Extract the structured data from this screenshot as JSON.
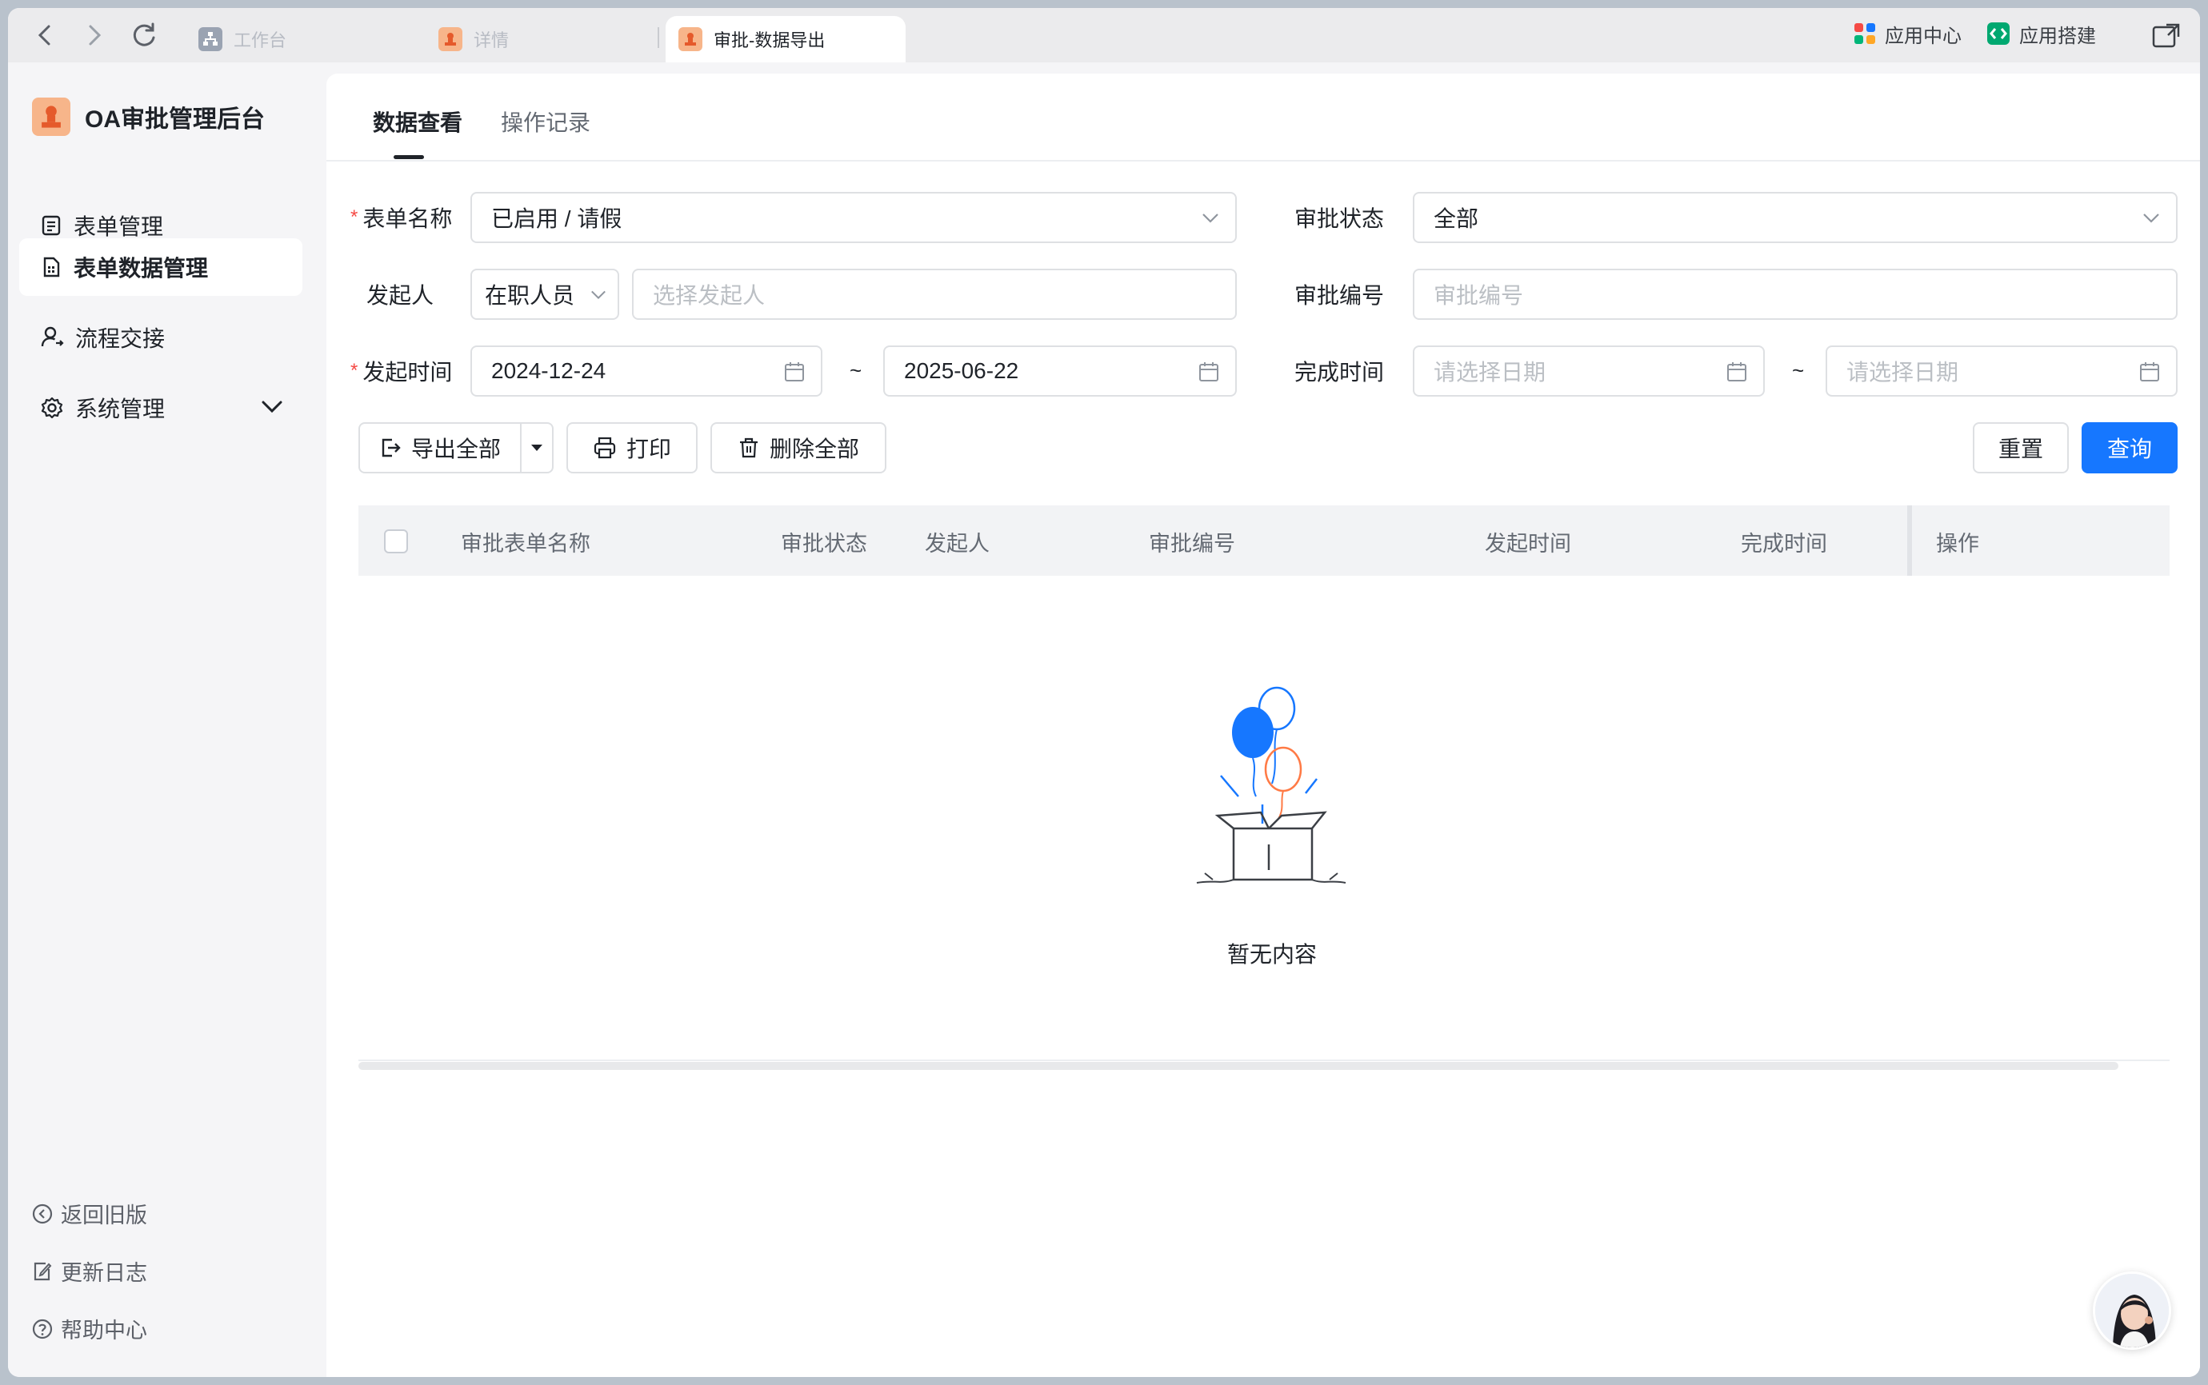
{
  "browser": {
    "tabs": [
      {
        "label": "工作台",
        "active": false
      },
      {
        "label": "详情",
        "active": false
      },
      {
        "label": "审批-数据导出",
        "active": true
      }
    ],
    "app_center": "应用中心",
    "app_builder": "应用搭建"
  },
  "sidebar": {
    "brand": "OA审批管理后台",
    "items": [
      {
        "label": "表单管理",
        "icon": "form-icon"
      },
      {
        "label": "表单数据管理",
        "icon": "form-data-icon",
        "active": true
      },
      {
        "label": "流程交接",
        "icon": "user-transfer-icon"
      },
      {
        "label": "系统管理",
        "icon": "gear-icon"
      }
    ],
    "bottom": [
      {
        "label": "返回旧版",
        "icon": "back-circle-icon"
      },
      {
        "label": "更新日志",
        "icon": "edit-log-icon"
      },
      {
        "label": "帮助中心",
        "icon": "help-icon"
      }
    ]
  },
  "main": {
    "tabs": [
      "数据查看",
      "操作记录"
    ],
    "filters": {
      "form_name_label": "表单名称",
      "form_name_value": "已启用 / 请假",
      "status_label": "审批状态",
      "status_value": "全部",
      "initiator_label": "发起人",
      "initiator_type": "在职人员",
      "initiator_placeholder": "选择发起人",
      "number_label": "审批编号",
      "number_placeholder": "审批编号",
      "start_time_label": "发起时间",
      "start_from": "2024-12-24",
      "start_to": "2025-06-22",
      "finish_time_label": "完成时间",
      "finish_from_placeholder": "请选择日期",
      "finish_to_placeholder": "请选择日期",
      "range_sep": "~"
    },
    "actions": {
      "export_all": "导出全部",
      "print": "打印",
      "delete_all": "删除全部",
      "reset": "重置",
      "query": "查询"
    },
    "table": {
      "columns": [
        "审批表单名称",
        "审批状态",
        "发起人",
        "审批编号",
        "发起时间",
        "完成时间",
        "操作"
      ],
      "rows": [],
      "empty_text": "暂无内容"
    }
  },
  "colors": {
    "primary": "#1677ff",
    "required": "#f54a45",
    "brand_logo": "#f7b58a"
  }
}
